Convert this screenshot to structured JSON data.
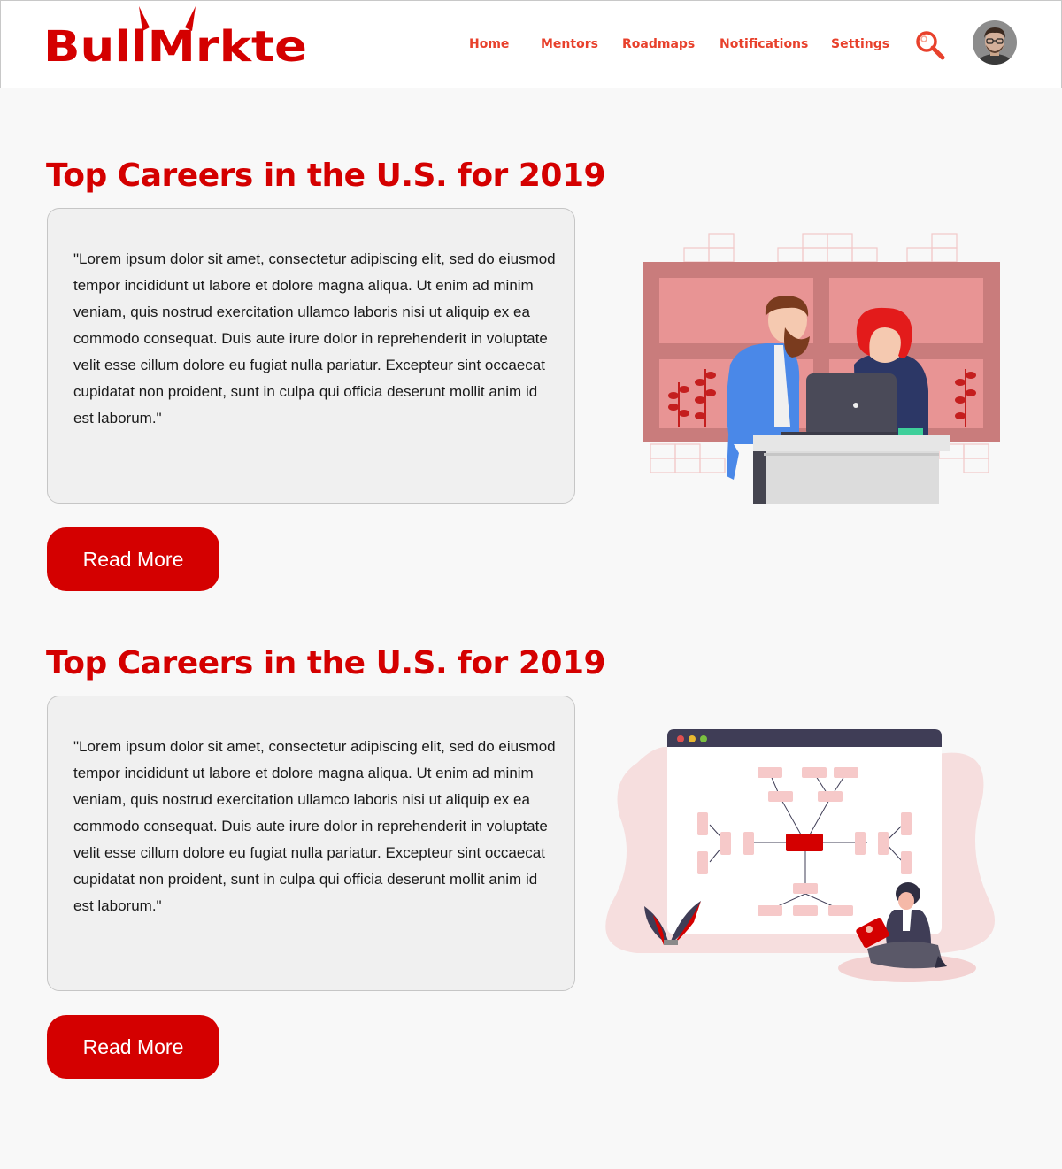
{
  "header": {
    "logo_text": "BullMrkte",
    "nav": [
      "Home",
      "Mentors",
      "Roadmaps",
      "Notifications",
      "Settings"
    ]
  },
  "articles": [
    {
      "title": "Top Careers in the U.S. for 2019",
      "body": "\"Lorem ipsum dolor sit amet, consectetur adipiscing elit, sed do eiusmod tempor incididunt ut labore et dolore magna aliqua. Ut enim ad minim veniam, quis nostrud exercitation ullamco laboris nisi ut aliquip ex ea commodo consequat. Duis aute irure dolor in reprehenderit in voluptate velit esse cillum dolore eu fugiat nulla pariatur. Excepteur sint occaecat cupidatat non proident, sunt in culpa qui officia deserunt mollit anim id est laborum.\"",
      "button": "Read More",
      "illustration": "two-people-at-laptop-illustration"
    },
    {
      "title": "Top Careers in the U.S. for 2019",
      "body": "\"Lorem ipsum dolor sit amet, consectetur adipiscing elit, sed do eiusmod tempor incididunt ut labore et dolore magna aliqua. Ut enim ad minim veniam, quis nostrud exercitation ullamco laboris nisi ut aliquip ex ea commodo consequat. Duis aute irure dolor in reprehenderit in voluptate velit esse cillum dolore eu fugiat nulla pariatur. Excepteur sint occaecat cupidatat non proident, sunt in culpa qui officia deserunt mollit anim id est laborum.\"",
      "button": "Read More",
      "illustration": "mind-map-browser-illustration"
    }
  ],
  "colors": {
    "brand": "#d40000",
    "nav": "#e8412c",
    "background": "#f8f8f8",
    "card": "#f0f0f0"
  }
}
